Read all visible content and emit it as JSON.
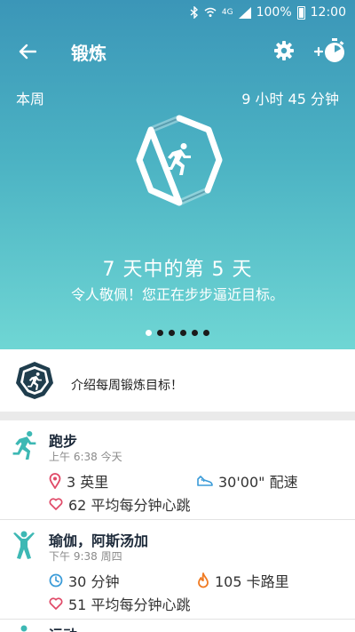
{
  "status_bar": {
    "network": "4G",
    "battery_percent": "100%",
    "time": "12:00"
  },
  "header": {
    "title": "锻炼"
  },
  "summary": {
    "period_label": "本周",
    "total_duration": "9 小时 45 分钟"
  },
  "goal": {
    "day_text": "7 天中的第 5 天",
    "praise_text": "令人敬佩！您正在步步逼近目标。"
  },
  "pager": {
    "count": 6,
    "active_index": 0
  },
  "intro": {
    "text": "介绍每周锻炼目标！"
  },
  "exercises": [
    {
      "name": "跑步",
      "time": "上午 6:38 今天",
      "icon": "running-icon",
      "stats": [
        {
          "icon": "location-pin-icon",
          "value": "3 英里"
        },
        {
          "icon": "shoe-icon",
          "value": "30'00\" 配速"
        },
        {
          "icon": "heart-icon",
          "value": "62 平均每分钟心跳"
        }
      ]
    },
    {
      "name": "瑜伽，阿斯汤加",
      "time": "下午 9:38 周四",
      "icon": "yoga-icon",
      "stats": [
        {
          "icon": "clock-icon",
          "value": "30 分钟"
        },
        {
          "icon": "flame-icon",
          "value": "105 卡路里"
        },
        {
          "icon": "heart-icon",
          "value": "51 平均每分钟心跳"
        }
      ]
    },
    {
      "name": "运动",
      "time": "",
      "icon": "activity-icon",
      "stats": []
    }
  ],
  "colors": {
    "accent": "#3db8b4",
    "hero_top": "#3b96b8",
    "hero_bottom": "#6fd6d4",
    "dark_navy": "#1d3a4a"
  }
}
